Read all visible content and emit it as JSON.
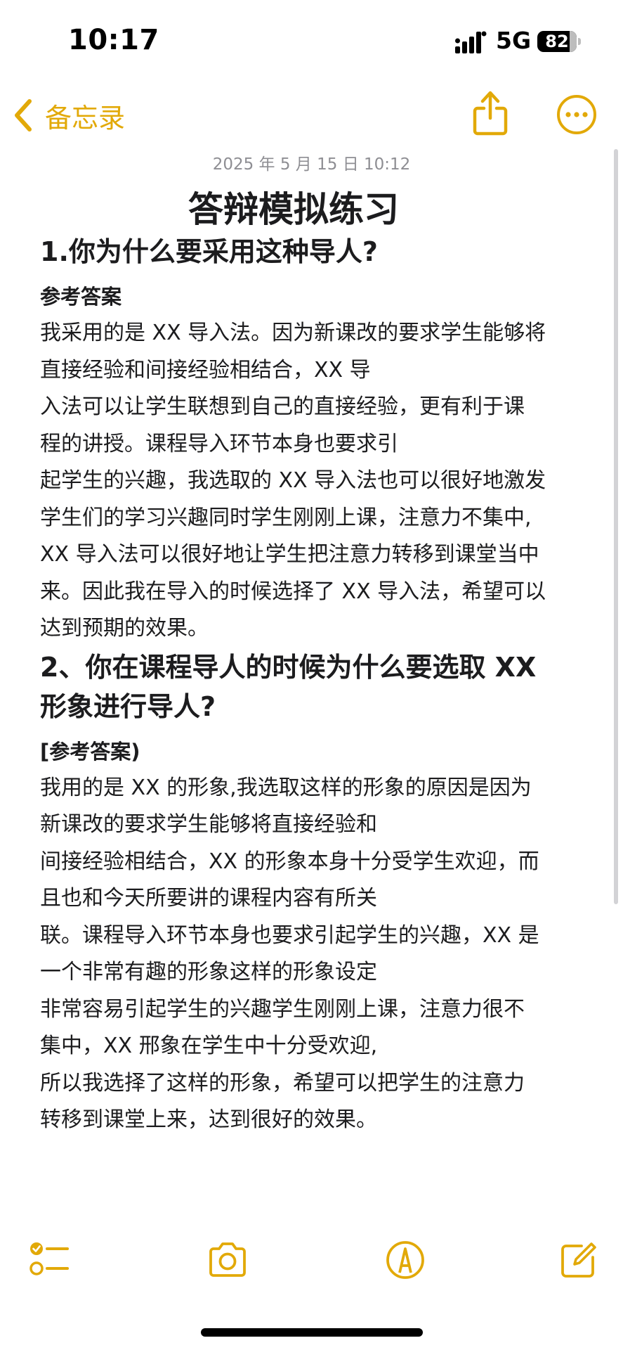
{
  "status_bar": {
    "time": "10:17",
    "network": "5G",
    "battery_level": "82",
    "battery_fraction": 0.82
  },
  "nav": {
    "back_label": "备忘录",
    "accent_color": "#e2a908"
  },
  "note": {
    "date": "2025 年 5 月 15 日 10:12",
    "title": "答辩模拟练习",
    "q1": {
      "heading": "1.你为什么要采用这种导人?",
      "answer_label": "参考答案",
      "lines": [
        "我采用的是 XX 导入法。因为新课改的要求学生能够将",
        "直接经验和间接经验相结合，XX 导",
        "入法可以让学生联想到自己的直接经验，更有利于课",
        "程的讲授。课程导入环节本身也要求引",
        "起学生的兴趣，我选取的 XX 导入法也可以很好地激发",
        "学生们的学习兴趣同时学生刚刚上课，注意力不集中,",
        "XX 导入法可以很好地让学生把注意力转移到课堂当中",
        "来。因此我在导入的时候选择了 XX 导入法，希望可以",
        "达到预期的效果。"
      ]
    },
    "q2": {
      "heading_line1": "2、你在课程导人的时候为什么要选取 XX",
      "heading_line2": "形象进行导人?",
      "answer_label": "[参考答案)",
      "lines": [
        "我用的是 XX 的形象,我选取这样的形象的原因是因为",
        "新课改的要求学生能够将直接经验和",
        "间接经验相结合，XX 的形象本身十分受学生欢迎，而",
        "且也和今天所要讲的课程内容有所关",
        "联。课程导入环节本身也要求引起学生的兴趣，XX 是",
        "一个非常有趣的形象这样的形象设定",
        "非常容易引起学生的兴趣学生刚刚上课，注意力很不",
        "集中，XX 邢象在学生中十分受欢迎,",
        "所以我选择了这样的形象，希望可以把学生的注意力",
        "转移到课堂上来，达到很好的效果。"
      ]
    }
  },
  "toolbar": {
    "items": [
      "checklist-icon",
      "camera-icon",
      "markup-icon",
      "compose-icon"
    ]
  }
}
